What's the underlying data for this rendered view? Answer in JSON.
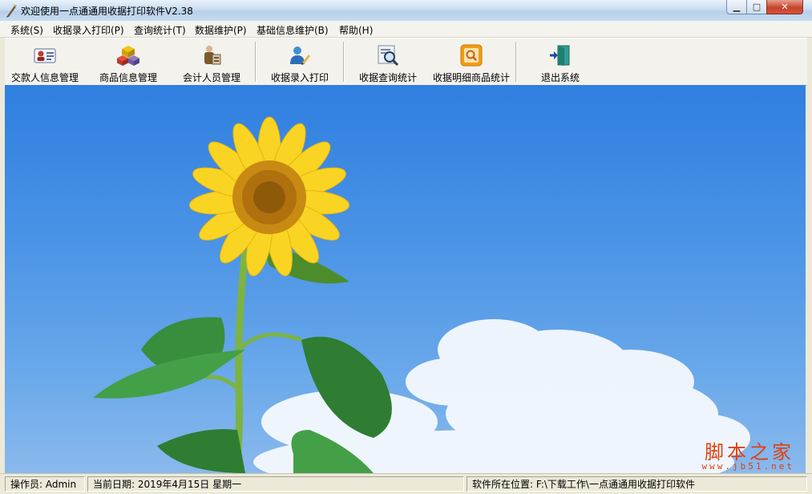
{
  "window": {
    "title": "欢迎使用一点通通用收据打印软件V2.38"
  },
  "menu": [
    {
      "label": "系统(S)"
    },
    {
      "label": "收据录入打印(P)"
    },
    {
      "label": "查询统计(T)"
    },
    {
      "label": "数据维护(P)"
    },
    {
      "label": "基础信息维护(B)"
    },
    {
      "label": "帮助(H)"
    }
  ],
  "toolbar": [
    {
      "label": "交款人信息管理",
      "icon": "contact-card-icon"
    },
    {
      "label": "商品信息管理",
      "icon": "cubes-icon"
    },
    {
      "label": "会计人员管理",
      "icon": "accountant-icon"
    },
    {
      "label": "收据录入打印",
      "icon": "user-edit-icon"
    },
    {
      "label": "收据查询统计",
      "icon": "magnifier-report-icon"
    },
    {
      "label": "收据明细商品统计",
      "icon": "orange-search-icon"
    },
    {
      "label": "退出系统",
      "icon": "exit-door-icon"
    }
  ],
  "watermark": {
    "title": "脚本之家",
    "url": "www.jb51.net"
  },
  "status": {
    "operator": "操作员: Admin",
    "date": "当前日期: 2019年4月15日 星期一",
    "location": "软件所在位置: F:\\下载工作\\一点通通用收据打印软件"
  },
  "colors": {
    "sky": "#3f8ce4",
    "watermark": "#e04010",
    "toolbar_bg": "#f3f2ed"
  }
}
